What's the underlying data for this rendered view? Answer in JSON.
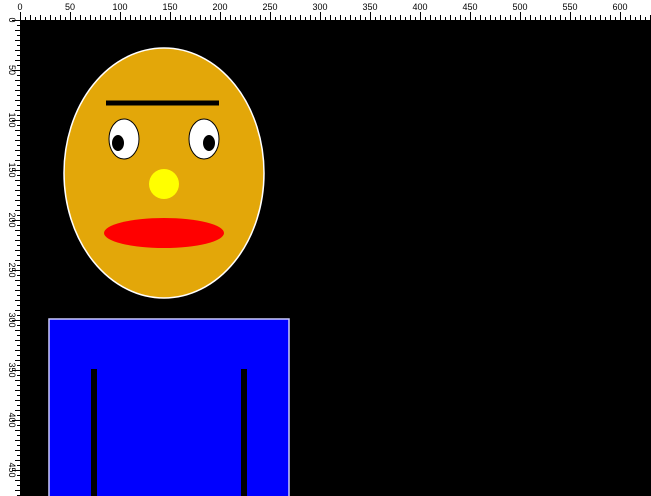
{
  "rulers": {
    "background": "#ffffff",
    "tick_color": "#000000",
    "top_labels": [
      "0",
      "50",
      "100",
      "150",
      "200",
      "250",
      "300",
      "350",
      "400",
      "450",
      "500",
      "550",
      "600"
    ],
    "left_labels": [
      "0",
      "50",
      "100",
      "150",
      "200",
      "250",
      "300",
      "350",
      "400",
      "450"
    ]
  },
  "canvas": {
    "background": "#000000"
  },
  "drawing": {
    "face": {
      "fill": "#e3a709",
      "stroke": "#ffffff"
    },
    "eyebrow": {
      "color": "#000000"
    },
    "eyes": {
      "white": "#ffffff",
      "pupil": "#000000",
      "outline": "#000000"
    },
    "nose": {
      "fill": "#ffff00"
    },
    "mouth": {
      "fill": "#ff0000"
    },
    "body": {
      "fill": "#0000ff",
      "stroke": "#ccccff"
    },
    "arms": {
      "color": "#000000"
    }
  }
}
